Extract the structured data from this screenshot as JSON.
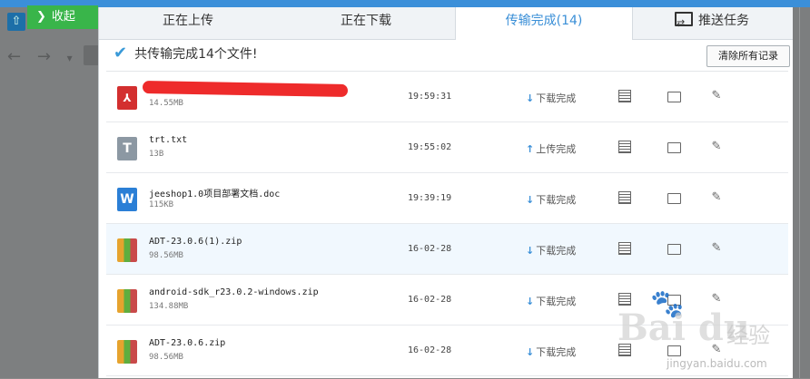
{
  "background": {
    "collapse_label": "收起",
    "nav_back": "←",
    "nav_forward": "→",
    "nav_dropdown": "▾"
  },
  "tabs": [
    {
      "label": "正在上传"
    },
    {
      "label": "正在下载"
    },
    {
      "label": "传输完成(14)",
      "active": true
    },
    {
      "label": "推送任务"
    }
  ],
  "summary": {
    "text": "共传输完成14个文件!"
  },
  "clear_button": "清除所有记录",
  "files": [
    {
      "name": "",
      "size": "14.55MB",
      "time": "19:59:31",
      "status": "下载完成",
      "status_dir": "down",
      "type": "pdf",
      "type_glyph": "⅄",
      "redacted": true
    },
    {
      "name": "trt.txt",
      "size": "13B",
      "time": "19:55:02",
      "status": "上传完成",
      "status_dir": "up",
      "type": "txt",
      "type_glyph": "T"
    },
    {
      "name": "jeeshop1.0项目部署文档.doc",
      "size": "115KB",
      "time": "19:39:19",
      "status": "下载完成",
      "status_dir": "down",
      "type": "doc",
      "type_glyph": "W"
    },
    {
      "name": "ADT-23.0.6(1).zip",
      "size": "98.56MB",
      "time": "16-02-28",
      "status": "下载完成",
      "status_dir": "down",
      "type": "zip",
      "type_glyph": ""
    },
    {
      "name": "android-sdk_r23.0.2-windows.zip",
      "size": "134.88MB",
      "time": "16-02-28",
      "status": "下载完成",
      "status_dir": "down",
      "type": "zip",
      "type_glyph": ""
    },
    {
      "name": "ADT-23.0.6.zip",
      "size": "98.56MB",
      "time": "16-02-28",
      "status": "下载完成",
      "status_dir": "down",
      "type": "zip",
      "type_glyph": ""
    }
  ],
  "icons": {
    "down_arrow": "↓",
    "up_arrow": "↑",
    "check": "✔",
    "chevron": "❯",
    "upload": "⇧",
    "broom": "✎"
  },
  "watermark": {
    "brand": "Bai du",
    "cn": "经验",
    "url": "jingyan.baidu.com"
  },
  "colors": {
    "accent": "#3a8fd7",
    "collapse_green": "#39b54a",
    "row_highlight": "#f1f8fe"
  }
}
